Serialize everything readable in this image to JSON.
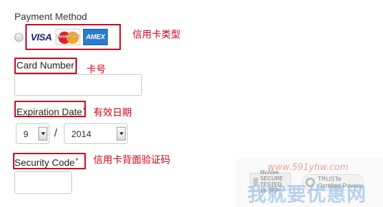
{
  "form": {
    "section_title": "Payment Method",
    "cards": {
      "visa": "VISA",
      "mastercard": "MasterCard",
      "amex": "AMEX"
    },
    "card_number": {
      "label": "Card Number",
      "required_mark": "*",
      "value": ""
    },
    "expiration": {
      "label": "Expiration Date",
      "required_mark": "*",
      "month": "9",
      "separator": "/",
      "year": "2014"
    },
    "security_code": {
      "label": "Security Code",
      "required_mark": "*",
      "value": ""
    }
  },
  "annotations": {
    "card_type": "信用卡类型",
    "card_number": "卡号",
    "expiration": "有效日期",
    "security_code": "信用卡背面验证码"
  },
  "seals": {
    "watermark_url": "www.591yhw.com",
    "mcafee": "McAfee SECURE",
    "mcafee_sub": "TESTED 18-SEP",
    "truste": "TRUSTe",
    "truste_sub": "Certified Privacy",
    "watermark_text": "我就要优惠网"
  },
  "colors": {
    "highlight_red": "#d0021b",
    "amex_blue": "#2a7bcf",
    "visa_navy": "#1a1f71"
  }
}
